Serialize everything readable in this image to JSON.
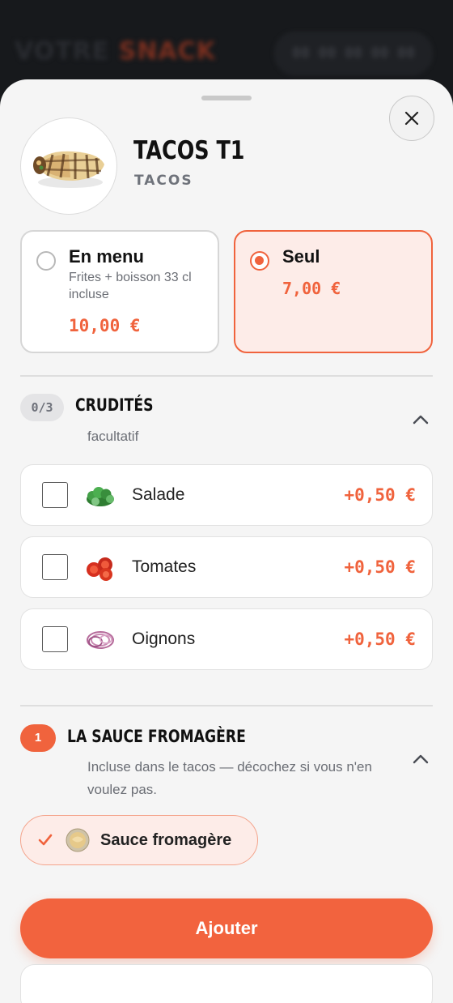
{
  "background": {
    "brand": "VOTRE",
    "brand_accent": "SNACK",
    "phone": "00 00 00 00 00"
  },
  "product": {
    "title": "TACOS T1",
    "category": "TACOS",
    "image_icon": "tacos-wrap-image"
  },
  "options": [
    {
      "title": "En menu",
      "description": "Frites + boisson 33 cl incluse",
      "price": "10,00 €",
      "selected": false
    },
    {
      "title": "Seul",
      "description": "",
      "price": "7,00 €",
      "selected": true
    }
  ],
  "crudites": {
    "count": "0/3",
    "title": "CRUDITÉS",
    "subtitle": "facultatif",
    "items": [
      {
        "label": "Salade",
        "price": "+0,50 €",
        "icon": "salad-icon",
        "checked": false
      },
      {
        "label": "Tomates",
        "price": "+0,50 €",
        "icon": "tomato-icon",
        "checked": false
      },
      {
        "label": "Oignons",
        "price": "+0,50 €",
        "icon": "onion-icon",
        "checked": false
      }
    ]
  },
  "sauce": {
    "badge": "1",
    "title": "LA SAUCE FROMAGÈRE",
    "subtitle": "Incluse dans le tacos — décochez si vous n'en voulez pas.",
    "chip_label": "Sauce fromagère",
    "chip_icon": "cheese-sauce-icon",
    "checked": true
  },
  "add_button": "Ajouter",
  "colors": {
    "accent": "#f0633d",
    "accent_light": "#fdece8",
    "sheet_bg": "#f5f5f5",
    "dark_bg": "#17191c"
  }
}
